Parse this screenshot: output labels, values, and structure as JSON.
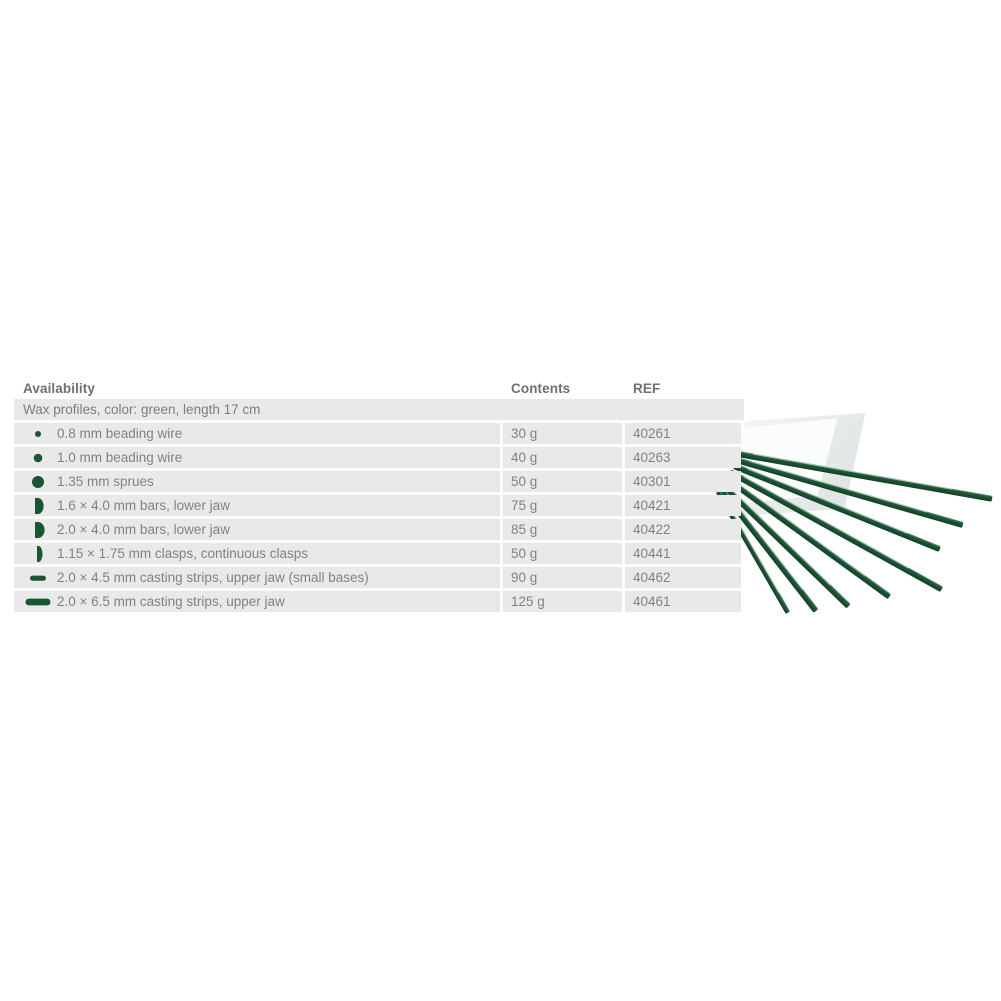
{
  "table": {
    "columns": {
      "availability": "Availability",
      "contents": "Contents",
      "ref": "REF"
    },
    "subheader": "Wax profiles, color: green, length 17 cm",
    "accent_color": "#1b5634",
    "row_background": "#e9e9e9",
    "text_color": "#808285",
    "rows": [
      {
        "icon": "wax-profile-round-small-icon",
        "label": "0.8 mm beading wire",
        "contents": "30 g",
        "ref": "40261"
      },
      {
        "icon": "wax-profile-round-medium-icon",
        "label": "1.0 mm beading wire",
        "contents": "40 g",
        "ref": "40263"
      },
      {
        "icon": "wax-profile-round-large-icon",
        "label": "1.35 mm sprues",
        "contents": "50 g",
        "ref": "40301"
      },
      {
        "icon": "wax-profile-bar-d-shape-icon",
        "label": "1.6 × 4.0 mm bars, lower jaw",
        "contents": "75 g",
        "ref": "40421"
      },
      {
        "icon": "wax-profile-bar-d-shape-wide-icon",
        "label": "2.0 × 4.0 mm bars, lower jaw",
        "contents": "85 g",
        "ref": "40422"
      },
      {
        "icon": "wax-profile-clasp-narrow-icon",
        "label": "1.15 × 1.75 mm clasps, continuous clasps",
        "contents": "50 g",
        "ref": "40441"
      },
      {
        "icon": "wax-profile-casting-strip-small-icon",
        "label": "2.0 × 4.5 mm casting strips, upper jaw (small bases)",
        "contents": "90 g",
        "ref": "40462"
      },
      {
        "icon": "wax-profile-casting-strip-large-icon",
        "label": "2.0 × 6.5 mm casting strips, upper jaw",
        "contents": "125 g",
        "ref": "40461"
      }
    ]
  },
  "product_photo": {
    "alt": "green wax profile strips fanned out",
    "strip_color": "#1d5434"
  }
}
